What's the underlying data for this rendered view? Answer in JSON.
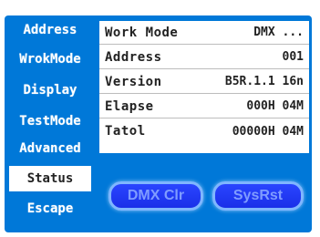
{
  "sidebar": {
    "items": [
      {
        "label": "Address",
        "active": false
      },
      {
        "label": "WrokMode",
        "active": false
      },
      {
        "label": "Display",
        "active": false
      },
      {
        "label": "TestMode",
        "active": false
      },
      {
        "label": "Advanced",
        "active": false
      },
      {
        "label": "Status",
        "active": true
      },
      {
        "label": "Escape",
        "active": false
      }
    ]
  },
  "status": {
    "rows": [
      {
        "label": "Work Mode",
        "value": "DMX ..."
      },
      {
        "label": "Address",
        "value": "001"
      },
      {
        "label": "Version",
        "value": "B5R.1.1 16n"
      },
      {
        "label": "Elapse",
        "value": "000H 04M"
      },
      {
        "label": "Tatol",
        "value": "00000H 04M"
      }
    ]
  },
  "buttons": {
    "dmx_clear": "DMX Clr",
    "sys_reset": "SysRst"
  },
  "colors": {
    "screen_background": "#0078d8",
    "panel_background": "#ffffff",
    "button_fill": "#1a2fe8",
    "button_border": "#7fb6ff"
  }
}
